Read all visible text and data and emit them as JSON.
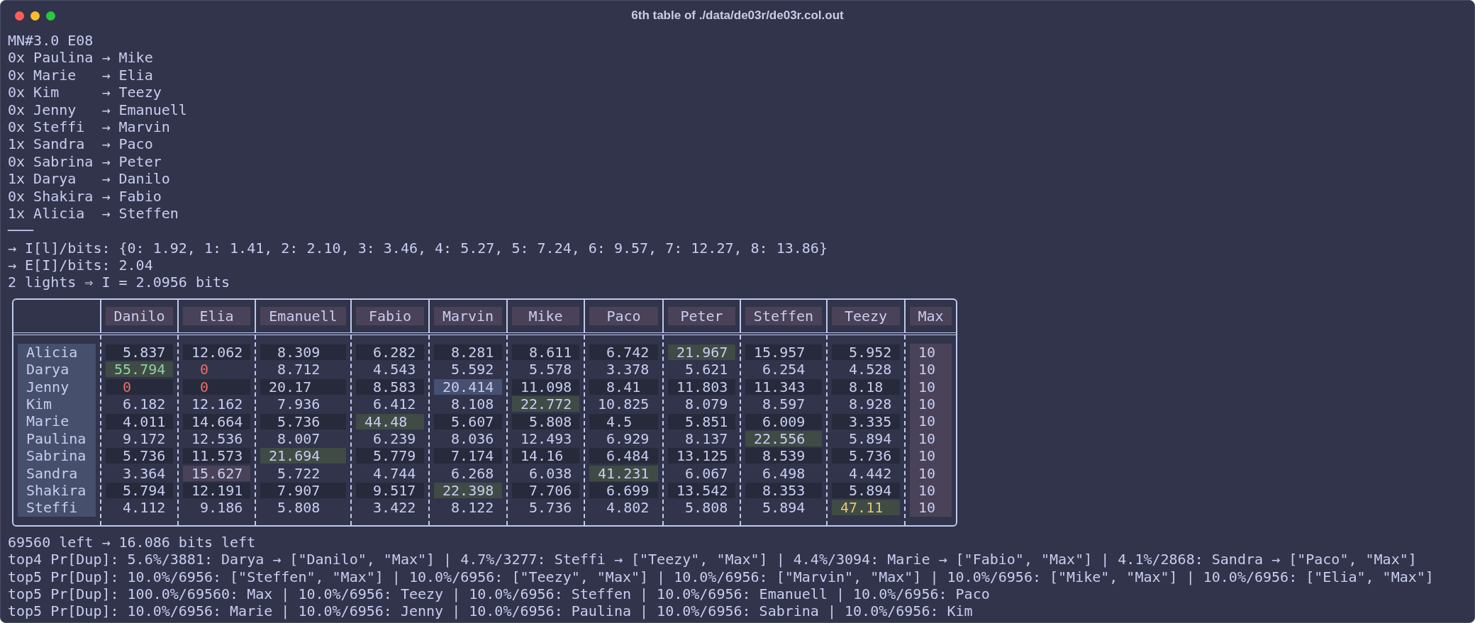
{
  "window": {
    "title": "6th table of ./data/de03r/de03r.col.out"
  },
  "lines": [
    "MN#3.0 E08",
    "0x Paulina → Mike",
    "0x Marie   → Elia",
    "0x Kim     → Teezy",
    "0x Jenny   → Emanuell",
    "0x Steffi  → Marvin",
    "1x Sandra  → Paco",
    "0x Sabrina → Peter",
    "1x Darya   → Danilo",
    "0x Shakira → Fabio",
    "1x Alicia  → Steffen",
    "───",
    "→ I[l]/bits: {0: 1.92, 1: 1.41, 2: 2.10, 3: 3.46, 4: 5.27, 5: 7.24, 6: 9.57, 7: 12.27, 8: 13.86}",
    "→ E[I]/bits: 2.04",
    "2 lights ⇒ I = 2.0956 bits"
  ],
  "table": {
    "columns": [
      "Danilo",
      "Elia",
      "Emanuell",
      "Fabio",
      "Marvin",
      "Mike",
      "Paco",
      "Peter",
      "Steffen",
      "Teezy",
      "Max"
    ],
    "rows": [
      {
        "label": "Alicia",
        "cells": [
          {
            "value": "5.837",
            "kind": "plain"
          },
          {
            "value": "12.062",
            "kind": "plain"
          },
          {
            "value": "8.309",
            "kind": "plain"
          },
          {
            "value": "6.282",
            "kind": "plain"
          },
          {
            "value": "8.281",
            "kind": "plain"
          },
          {
            "value": "8.611",
            "kind": "plain"
          },
          {
            "value": "6.742",
            "kind": "plain"
          },
          {
            "value": "21.967",
            "kind": "high"
          },
          {
            "value": "15.957",
            "kind": "plain"
          },
          {
            "value": "5.952",
            "kind": "plain"
          },
          {
            "value": "10",
            "kind": "max"
          }
        ]
      },
      {
        "label": "Darya",
        "cells": [
          {
            "value": "55.794",
            "kind": "certain"
          },
          {
            "value": "0",
            "kind": "zero"
          },
          {
            "value": "8.712",
            "kind": "plain"
          },
          {
            "value": "4.543",
            "kind": "plain"
          },
          {
            "value": "5.592",
            "kind": "plain"
          },
          {
            "value": "5.578",
            "kind": "plain"
          },
          {
            "value": "3.378",
            "kind": "plain"
          },
          {
            "value": "5.621",
            "kind": "plain"
          },
          {
            "value": "6.254",
            "kind": "plain"
          },
          {
            "value": "4.528",
            "kind": "plain"
          },
          {
            "value": "10",
            "kind": "max"
          }
        ]
      },
      {
        "label": "Jenny",
        "cells": [
          {
            "value": "0",
            "kind": "zero"
          },
          {
            "value": "0",
            "kind": "zero"
          },
          {
            "value": "20.17",
            "kind": "plain"
          },
          {
            "value": "8.583",
            "kind": "plain"
          },
          {
            "value": "20.414",
            "kind": "marked"
          },
          {
            "value": "11.098",
            "kind": "plain"
          },
          {
            "value": "8.41",
            "kind": "plain"
          },
          {
            "value": "11.803",
            "kind": "plain"
          },
          {
            "value": "11.343",
            "kind": "plain"
          },
          {
            "value": "8.18",
            "kind": "plain"
          },
          {
            "value": "10",
            "kind": "max"
          }
        ]
      },
      {
        "label": "Kim",
        "cells": [
          {
            "value": "6.182",
            "kind": "plain"
          },
          {
            "value": "12.162",
            "kind": "plain"
          },
          {
            "value": "7.936",
            "kind": "plain"
          },
          {
            "value": "6.412",
            "kind": "plain"
          },
          {
            "value": "8.108",
            "kind": "plain"
          },
          {
            "value": "22.772",
            "kind": "high"
          },
          {
            "value": "10.825",
            "kind": "plain"
          },
          {
            "value": "8.079",
            "kind": "plain"
          },
          {
            "value": "8.597",
            "kind": "plain"
          },
          {
            "value": "8.928",
            "kind": "plain"
          },
          {
            "value": "10",
            "kind": "max"
          }
        ]
      },
      {
        "label": "Marie",
        "cells": [
          {
            "value": "4.011",
            "kind": "plain"
          },
          {
            "value": "14.664",
            "kind": "plain"
          },
          {
            "value": "5.736",
            "kind": "plain"
          },
          {
            "value": "44.48",
            "kind": "high"
          },
          {
            "value": "5.607",
            "kind": "plain"
          },
          {
            "value": "5.808",
            "kind": "plain"
          },
          {
            "value": "4.5",
            "kind": "plain"
          },
          {
            "value": "5.851",
            "kind": "plain"
          },
          {
            "value": "6.009",
            "kind": "plain"
          },
          {
            "value": "3.335",
            "kind": "plain"
          },
          {
            "value": "10",
            "kind": "max"
          }
        ]
      },
      {
        "label": "Paulina",
        "cells": [
          {
            "value": "9.172",
            "kind": "plain"
          },
          {
            "value": "12.536",
            "kind": "plain"
          },
          {
            "value": "8.007",
            "kind": "plain"
          },
          {
            "value": "6.239",
            "kind": "plain"
          },
          {
            "value": "8.036",
            "kind": "plain"
          },
          {
            "value": "12.493",
            "kind": "plain"
          },
          {
            "value": "6.929",
            "kind": "plain"
          },
          {
            "value": "8.137",
            "kind": "plain"
          },
          {
            "value": "22.556",
            "kind": "high"
          },
          {
            "value": "5.894",
            "kind": "plain"
          },
          {
            "value": "10",
            "kind": "max"
          }
        ]
      },
      {
        "label": "Sabrina",
        "cells": [
          {
            "value": "5.736",
            "kind": "plain"
          },
          {
            "value": "11.573",
            "kind": "plain"
          },
          {
            "value": "21.694",
            "kind": "high"
          },
          {
            "value": "5.779",
            "kind": "plain"
          },
          {
            "value": "7.174",
            "kind": "plain"
          },
          {
            "value": "14.16",
            "kind": "plain"
          },
          {
            "value": "6.484",
            "kind": "plain"
          },
          {
            "value": "13.125",
            "kind": "plain"
          },
          {
            "value": "8.539",
            "kind": "plain"
          },
          {
            "value": "5.736",
            "kind": "plain"
          },
          {
            "value": "10",
            "kind": "max"
          }
        ]
      },
      {
        "label": "Sandra",
        "cells": [
          {
            "value": "3.364",
            "kind": "plain"
          },
          {
            "value": "15.627",
            "kind": "pair"
          },
          {
            "value": "5.722",
            "kind": "plain"
          },
          {
            "value": "4.744",
            "kind": "plain"
          },
          {
            "value": "6.268",
            "kind": "plain"
          },
          {
            "value": "6.038",
            "kind": "plain"
          },
          {
            "value": "41.231",
            "kind": "high"
          },
          {
            "value": "6.067",
            "kind": "plain"
          },
          {
            "value": "6.498",
            "kind": "plain"
          },
          {
            "value": "4.442",
            "kind": "plain"
          },
          {
            "value": "10",
            "kind": "max"
          }
        ]
      },
      {
        "label": "Shakira",
        "cells": [
          {
            "value": "5.794",
            "kind": "plain"
          },
          {
            "value": "12.191",
            "kind": "plain"
          },
          {
            "value": "7.907",
            "kind": "plain"
          },
          {
            "value": "9.517",
            "kind": "plain"
          },
          {
            "value": "22.398",
            "kind": "high"
          },
          {
            "value": "7.706",
            "kind": "plain"
          },
          {
            "value": "6.699",
            "kind": "plain"
          },
          {
            "value": "13.542",
            "kind": "plain"
          },
          {
            "value": "8.353",
            "kind": "plain"
          },
          {
            "value": "5.894",
            "kind": "plain"
          },
          {
            "value": "10",
            "kind": "max"
          }
        ]
      },
      {
        "label": "Steffi",
        "cells": [
          {
            "value": "4.112",
            "kind": "plain"
          },
          {
            "value": "9.186",
            "kind": "plain"
          },
          {
            "value": "5.808",
            "kind": "plain"
          },
          {
            "value": "3.422",
            "kind": "plain"
          },
          {
            "value": "8.122",
            "kind": "plain"
          },
          {
            "value": "5.736",
            "kind": "plain"
          },
          {
            "value": "4.802",
            "kind": "plain"
          },
          {
            "value": "5.808",
            "kind": "plain"
          },
          {
            "value": "5.894",
            "kind": "plain"
          },
          {
            "value": "47.11",
            "kind": "top"
          },
          {
            "value": "10",
            "kind": "max"
          }
        ]
      }
    ]
  },
  "footer_lines": [
    "69560 left → 16.086 bits left",
    "top4 Pr[Dup]: 5.6%/3881: Darya → [\"Danilo\", \"Max\"] | 4.7%/3277: Steffi → [\"Teezy\", \"Max\"] | 4.4%/3094: Marie → [\"Fabio\", \"Max\"] | 4.1%/2868: Sandra → [\"Paco\", \"Max\"]",
    "top5 Pr[Dup]: 10.0%/6956: [\"Steffen\", \"Max\"] | 10.0%/6956: [\"Teezy\", \"Max\"] | 10.0%/6956: [\"Marvin\", \"Max\"] | 10.0%/6956: [\"Mike\", \"Max\"] | 10.0%/6956: [\"Elia\", \"Max\"]",
    "top5 Pr[Dup]: 100.0%/69560: Max | 10.0%/6956: Teezy | 10.0%/6956: Steffen | 10.0%/6956: Emanuell | 10.0%/6956: Paco",
    "top5 Pr[Dup]: 10.0%/6956: Marie | 10.0%/6956: Jenny | 10.0%/6956: Paulina | 10.0%/6956: Sabrina | 10.0%/6956: Kim"
  ]
}
